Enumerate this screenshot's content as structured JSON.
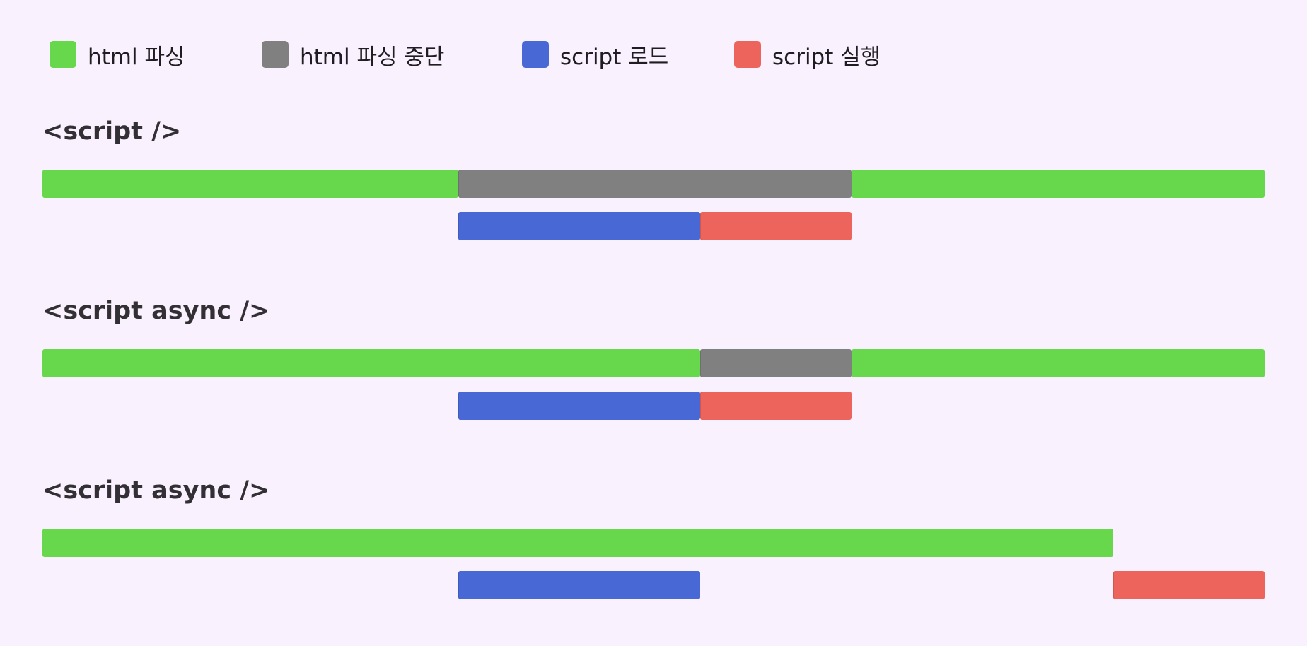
{
  "legend": [
    {
      "key": "parse",
      "label": "html 파싱",
      "color": "#67d74b"
    },
    {
      "key": "pause",
      "label": "html 파싱 중단",
      "color": "#808080"
    },
    {
      "key": "load",
      "label": "script 로드",
      "color": "#4868d6"
    },
    {
      "key": "exec",
      "label": "script 실행",
      "color": "#ec645b"
    }
  ],
  "scale": {
    "start": 0,
    "end": 100
  },
  "sections": [
    {
      "title": "<script />",
      "tracks": [
        [
          {
            "phase": "parse",
            "start": 0,
            "end": 34
          },
          {
            "phase": "pause",
            "start": 34,
            "end": 66.2
          },
          {
            "phase": "parse",
            "start": 66.2,
            "end": 100
          }
        ],
        [
          {
            "phase": "load",
            "start": 34,
            "end": 53.8
          },
          {
            "phase": "exec",
            "start": 53.8,
            "end": 66.2
          }
        ]
      ]
    },
    {
      "title": "<script async />",
      "tracks": [
        [
          {
            "phase": "parse",
            "start": 0,
            "end": 53.8
          },
          {
            "phase": "pause",
            "start": 53.8,
            "end": 66.2
          },
          {
            "phase": "parse",
            "start": 66.2,
            "end": 100
          }
        ],
        [
          {
            "phase": "load",
            "start": 34,
            "end": 53.8
          },
          {
            "phase": "exec",
            "start": 53.8,
            "end": 66.2
          }
        ]
      ]
    },
    {
      "title": "<script async />",
      "tracks": [
        [
          {
            "phase": "parse",
            "start": 0,
            "end": 87.6
          }
        ],
        [
          {
            "phase": "load",
            "start": 34,
            "end": 53.8
          },
          {
            "phase": "exec",
            "start": 87.6,
            "end": 100
          }
        ]
      ]
    }
  ]
}
